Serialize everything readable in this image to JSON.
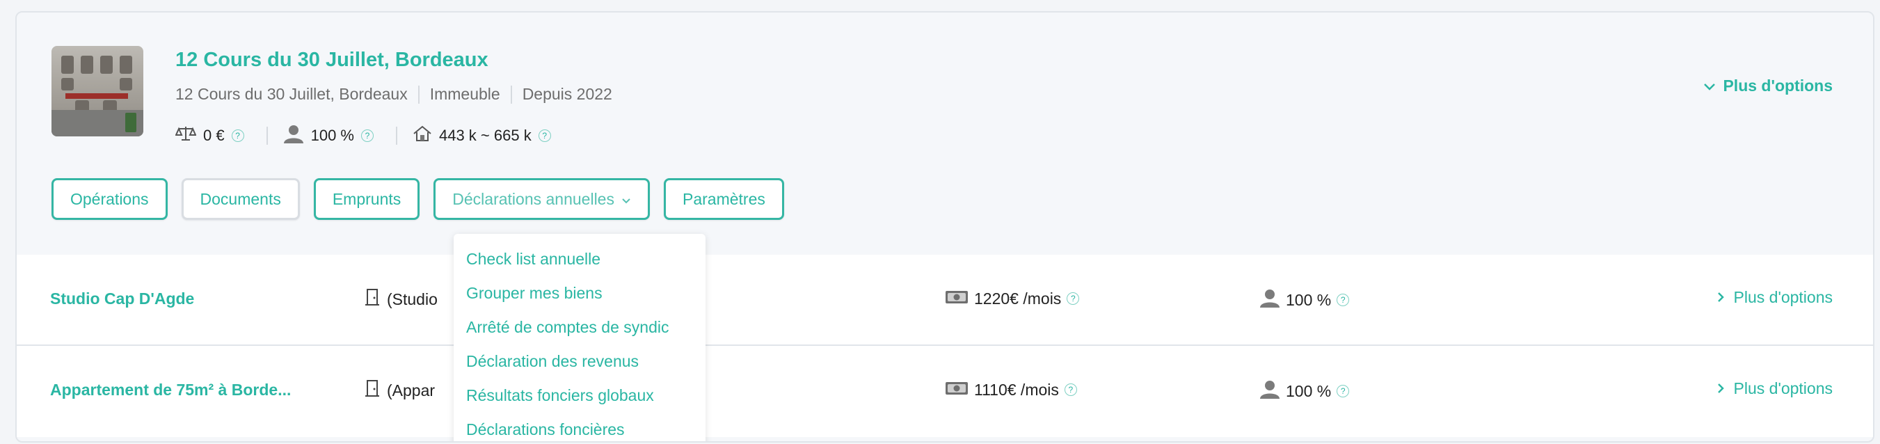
{
  "property": {
    "title": "12 Cours du 30 Juillet, Bordeaux",
    "address": "12 Cours du 30 Juillet, Bordeaux",
    "kind": "Immeuble",
    "since": "Depuis 2022",
    "balance": "0 €",
    "ownership": "100 %",
    "valuation": "443 k ~ 665 k",
    "more_options": "Plus d'options"
  },
  "tabs": {
    "operations": "Opérations",
    "documents": "Documents",
    "emprunts": "Emprunts",
    "declarations": "Déclarations annuelles",
    "parametres": "Paramètres"
  },
  "dropdown": {
    "items": [
      "Check list annuelle",
      "Grouper mes biens",
      "Arrêté de comptes de syndic",
      "Déclaration des revenus",
      "Résultats fonciers globaux",
      "Déclarations foncières"
    ]
  },
  "units": [
    {
      "name": "Studio Cap D'Agde",
      "type_text": "(Studio",
      "rent": "1220€ /mois",
      "ownership": "100 %",
      "more": "Plus d'options"
    },
    {
      "name": "Appartement de 75m² à Borde...",
      "type_text": "(Appar",
      "rent": "1110€ /mois",
      "ownership": "100 %",
      "more": "Plus d'options"
    }
  ],
  "colors": {
    "accent": "#2ab6a3",
    "border": "#e1e5ea",
    "background": "#f5f7fa"
  },
  "icons": {
    "balance": "scale-icon",
    "ownership": "user-icon",
    "valuation": "house-icon",
    "help": "question-circle-icon",
    "rent": "banknote-icon",
    "type": "door-icon",
    "chevron_down": "chevron-down-icon",
    "chevron_right": "chevron-right-icon"
  }
}
